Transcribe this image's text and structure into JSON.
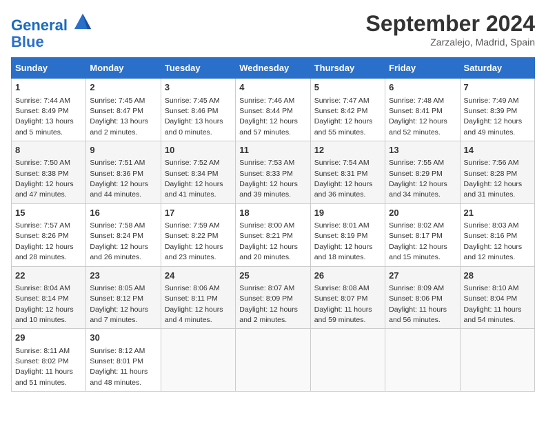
{
  "header": {
    "logo_line1": "General",
    "logo_line2": "Blue",
    "month": "September 2024",
    "location": "Zarzalejo, Madrid, Spain"
  },
  "columns": [
    "Sunday",
    "Monday",
    "Tuesday",
    "Wednesday",
    "Thursday",
    "Friday",
    "Saturday"
  ],
  "weeks": [
    [
      {
        "day": "1",
        "info": "Sunrise: 7:44 AM\nSunset: 8:49 PM\nDaylight: 13 hours\nand 5 minutes."
      },
      {
        "day": "2",
        "info": "Sunrise: 7:45 AM\nSunset: 8:47 PM\nDaylight: 13 hours\nand 2 minutes."
      },
      {
        "day": "3",
        "info": "Sunrise: 7:45 AM\nSunset: 8:46 PM\nDaylight: 13 hours\nand 0 minutes."
      },
      {
        "day": "4",
        "info": "Sunrise: 7:46 AM\nSunset: 8:44 PM\nDaylight: 12 hours\nand 57 minutes."
      },
      {
        "day": "5",
        "info": "Sunrise: 7:47 AM\nSunset: 8:42 PM\nDaylight: 12 hours\nand 55 minutes."
      },
      {
        "day": "6",
        "info": "Sunrise: 7:48 AM\nSunset: 8:41 PM\nDaylight: 12 hours\nand 52 minutes."
      },
      {
        "day": "7",
        "info": "Sunrise: 7:49 AM\nSunset: 8:39 PM\nDaylight: 12 hours\nand 49 minutes."
      }
    ],
    [
      {
        "day": "8",
        "info": "Sunrise: 7:50 AM\nSunset: 8:38 PM\nDaylight: 12 hours\nand 47 minutes."
      },
      {
        "day": "9",
        "info": "Sunrise: 7:51 AM\nSunset: 8:36 PM\nDaylight: 12 hours\nand 44 minutes."
      },
      {
        "day": "10",
        "info": "Sunrise: 7:52 AM\nSunset: 8:34 PM\nDaylight: 12 hours\nand 41 minutes."
      },
      {
        "day": "11",
        "info": "Sunrise: 7:53 AM\nSunset: 8:33 PM\nDaylight: 12 hours\nand 39 minutes."
      },
      {
        "day": "12",
        "info": "Sunrise: 7:54 AM\nSunset: 8:31 PM\nDaylight: 12 hours\nand 36 minutes."
      },
      {
        "day": "13",
        "info": "Sunrise: 7:55 AM\nSunset: 8:29 PM\nDaylight: 12 hours\nand 34 minutes."
      },
      {
        "day": "14",
        "info": "Sunrise: 7:56 AM\nSunset: 8:28 PM\nDaylight: 12 hours\nand 31 minutes."
      }
    ],
    [
      {
        "day": "15",
        "info": "Sunrise: 7:57 AM\nSunset: 8:26 PM\nDaylight: 12 hours\nand 28 minutes."
      },
      {
        "day": "16",
        "info": "Sunrise: 7:58 AM\nSunset: 8:24 PM\nDaylight: 12 hours\nand 26 minutes."
      },
      {
        "day": "17",
        "info": "Sunrise: 7:59 AM\nSunset: 8:22 PM\nDaylight: 12 hours\nand 23 minutes."
      },
      {
        "day": "18",
        "info": "Sunrise: 8:00 AM\nSunset: 8:21 PM\nDaylight: 12 hours\nand 20 minutes."
      },
      {
        "day": "19",
        "info": "Sunrise: 8:01 AM\nSunset: 8:19 PM\nDaylight: 12 hours\nand 18 minutes."
      },
      {
        "day": "20",
        "info": "Sunrise: 8:02 AM\nSunset: 8:17 PM\nDaylight: 12 hours\nand 15 minutes."
      },
      {
        "day": "21",
        "info": "Sunrise: 8:03 AM\nSunset: 8:16 PM\nDaylight: 12 hours\nand 12 minutes."
      }
    ],
    [
      {
        "day": "22",
        "info": "Sunrise: 8:04 AM\nSunset: 8:14 PM\nDaylight: 12 hours\nand 10 minutes."
      },
      {
        "day": "23",
        "info": "Sunrise: 8:05 AM\nSunset: 8:12 PM\nDaylight: 12 hours\nand 7 minutes."
      },
      {
        "day": "24",
        "info": "Sunrise: 8:06 AM\nSunset: 8:11 PM\nDaylight: 12 hours\nand 4 minutes."
      },
      {
        "day": "25",
        "info": "Sunrise: 8:07 AM\nSunset: 8:09 PM\nDaylight: 12 hours\nand 2 minutes."
      },
      {
        "day": "26",
        "info": "Sunrise: 8:08 AM\nSunset: 8:07 PM\nDaylight: 11 hours\nand 59 minutes."
      },
      {
        "day": "27",
        "info": "Sunrise: 8:09 AM\nSunset: 8:06 PM\nDaylight: 11 hours\nand 56 minutes."
      },
      {
        "day": "28",
        "info": "Sunrise: 8:10 AM\nSunset: 8:04 PM\nDaylight: 11 hours\nand 54 minutes."
      }
    ],
    [
      {
        "day": "29",
        "info": "Sunrise: 8:11 AM\nSunset: 8:02 PM\nDaylight: 11 hours\nand 51 minutes."
      },
      {
        "day": "30",
        "info": "Sunrise: 8:12 AM\nSunset: 8:01 PM\nDaylight: 11 hours\nand 48 minutes."
      },
      null,
      null,
      null,
      null,
      null
    ]
  ]
}
